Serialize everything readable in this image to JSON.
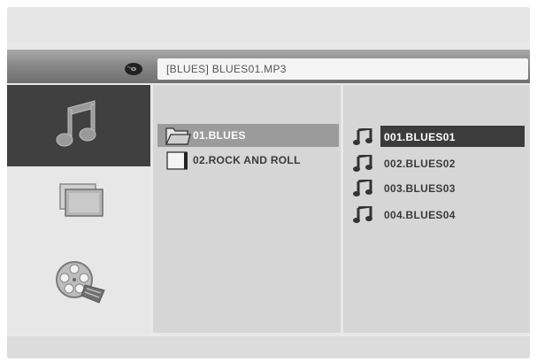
{
  "path_bar": {
    "disc_icon": "disc-icon",
    "path": "[BLUES] BLUES01.MP3"
  },
  "sidebar": {
    "items": [
      {
        "name": "music",
        "icon": "music-note-icon",
        "selected": true
      },
      {
        "name": "photo",
        "icon": "photo-frame-icon",
        "selected": false
      },
      {
        "name": "video",
        "icon": "film-reel-icon",
        "selected": false
      }
    ]
  },
  "folders": [
    {
      "label": "01.BLUES",
      "icon": "open-folder-icon",
      "selected": true
    },
    {
      "label": "02.ROCK AND ROLL",
      "icon": "folder-icon",
      "selected": false
    }
  ],
  "tracks": [
    {
      "label": "001.BLUES01",
      "icon": "music-note-icon",
      "selected": true
    },
    {
      "label": "002.BLUES02",
      "icon": "music-note-icon",
      "selected": false
    },
    {
      "label": "003.BLUES03",
      "icon": "music-note-icon",
      "selected": false
    },
    {
      "label": "004.BLUES04",
      "icon": "music-note-icon",
      "selected": false
    }
  ],
  "colors": {
    "selection_dark": "#3c3c3c",
    "selection_mid": "#9b9b9b",
    "pane_bg": "#d6d6d6"
  }
}
